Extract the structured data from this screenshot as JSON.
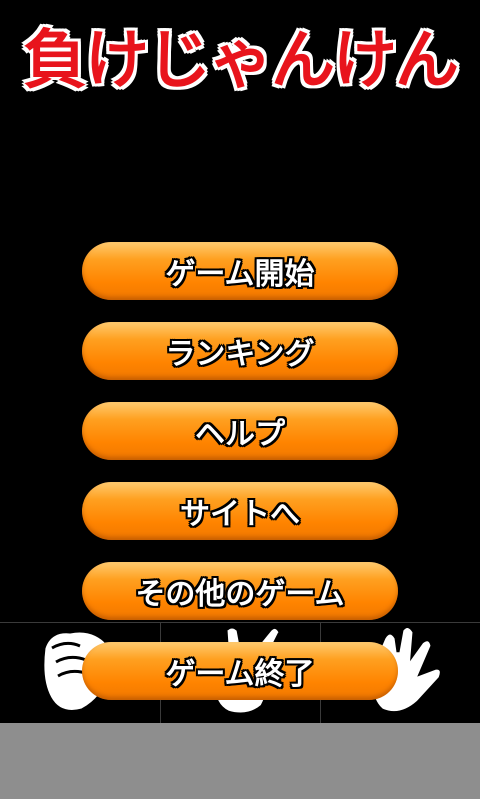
{
  "title": "負けじゃんけん",
  "menu": {
    "start": "ゲーム開始",
    "ranking": "ランキング",
    "help": "ヘルプ",
    "site": "サイトへ",
    "other_games": "その他のゲーム",
    "exit": "ゲーム終了"
  },
  "hands": [
    "rock-hand-icon",
    "scissors-hand-icon",
    "paper-hand-icon"
  ],
  "colors": {
    "title": "#e8141c",
    "button": "#ff8a00",
    "background": "#000000",
    "footer": "#8e8e8e"
  }
}
